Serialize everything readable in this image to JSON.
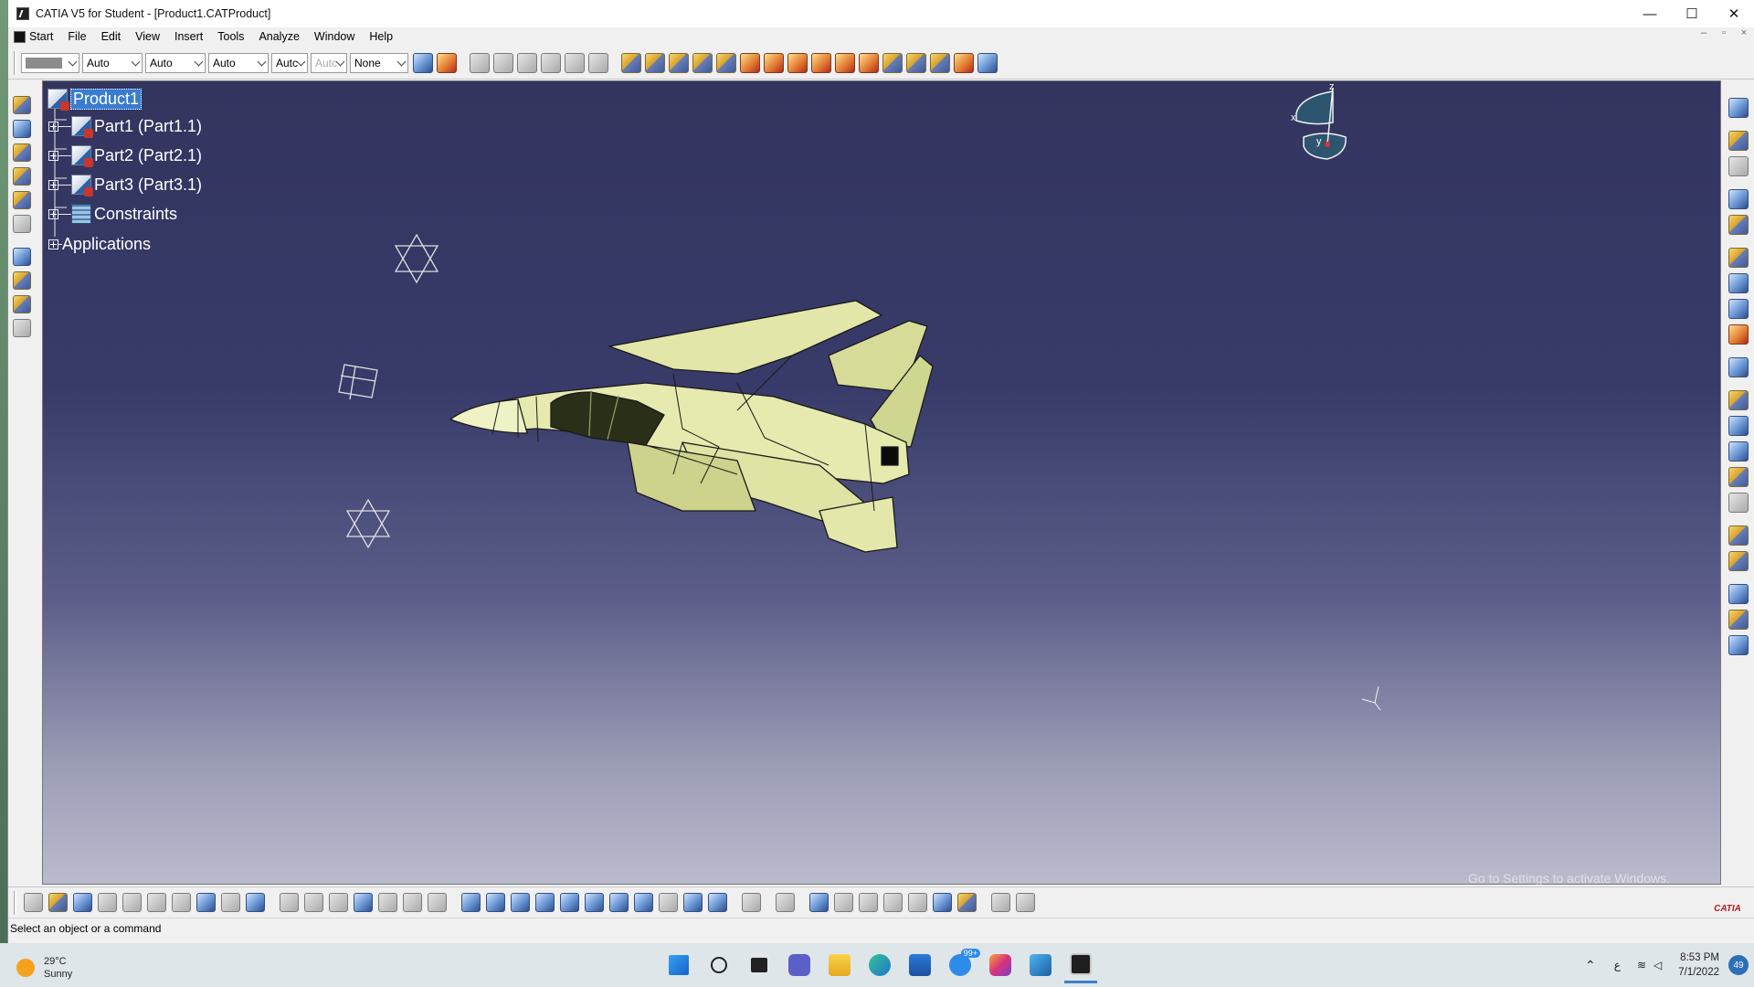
{
  "window": {
    "title": "CATIA V5 for Student - [Product1.CATProduct]",
    "controls": {
      "minimize": "—",
      "maximize": "☐",
      "close": "✕"
    }
  },
  "menu": {
    "items": [
      "Start",
      "File",
      "Edit",
      "View",
      "Insert",
      "Tools",
      "Analyze",
      "Window",
      "Help"
    ],
    "mdi": [
      "–",
      "▫",
      "×"
    ]
  },
  "toolbar": {
    "combos": [
      "Auto",
      "Auto",
      "Auto",
      "Autc",
      "Autc",
      "None"
    ]
  },
  "spec_tree": {
    "root": "Product1",
    "children": [
      "Part1 (Part1.1)",
      "Part2 (Part2.1)",
      "Part3 (Part3.1)",
      "Constraints"
    ],
    "applications": "Applications"
  },
  "compass_axes": {
    "x": "x",
    "y": "y",
    "z": "z"
  },
  "watermark": "Go to Settings to activate Windows.",
  "status": {
    "message": "Select an object or a command"
  },
  "logo_text": "CATIA",
  "taskbar": {
    "weather_temp": "29°C",
    "weather_desc": "Sunny",
    "notif_count": "99+",
    "time": "8:53 PM",
    "date": "7/1/2022",
    "badge": "49"
  }
}
